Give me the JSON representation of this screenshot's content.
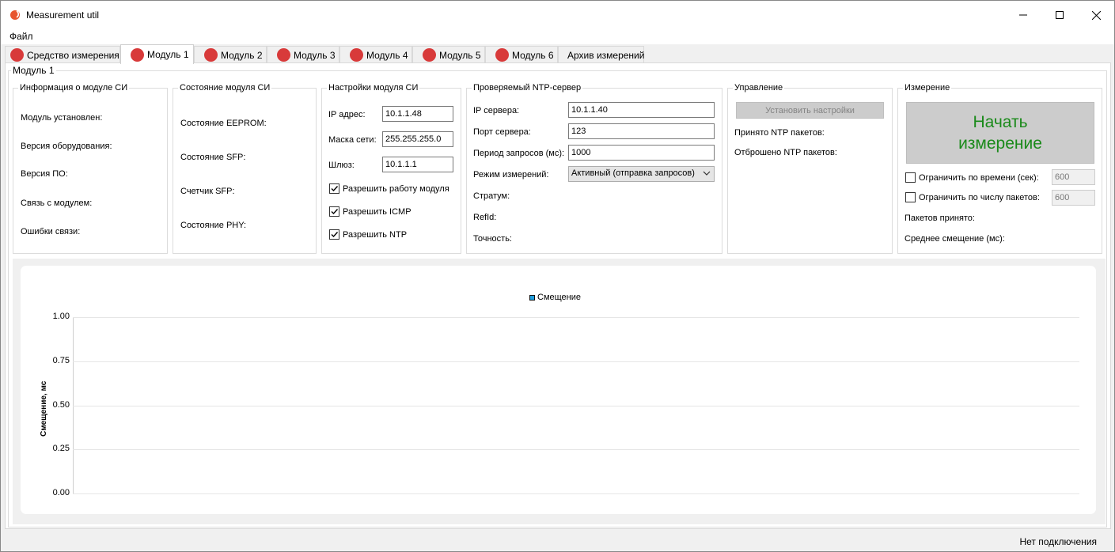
{
  "window": {
    "title": "Measurement util",
    "accent": "#e8552f"
  },
  "menu": {
    "file": "Файл"
  },
  "tabs": [
    {
      "label": "Средство измерения"
    },
    {
      "label": "Модуль 1"
    },
    {
      "label": "Модуль 2"
    },
    {
      "label": "Модуль 3"
    },
    {
      "label": "Модуль 4"
    },
    {
      "label": "Модуль 5"
    },
    {
      "label": "Модуль 6"
    },
    {
      "label": "Архив измерений"
    }
  ],
  "tab_status_color": "#d83a3a",
  "module": {
    "title": "Модуль 1",
    "info": {
      "title": "Информация о модуле СИ",
      "installed": "Модуль установлен:",
      "hw_version": "Версия оборудования:",
      "sw_version": "Версия ПО:",
      "link": "Связь с модулем:",
      "errors": "Ошибки связи:"
    },
    "state": {
      "title": "Состояние модуля СИ",
      "eeprom": "Состояние EEPROM:",
      "sfp": "Состояние SFP:",
      "sfp_counter": "Счетчик SFP:",
      "phy": "Состояние PHY:"
    },
    "settings": {
      "title": "Настройки модуля СИ",
      "ip_label": "IP адрес:",
      "ip_value": "10.1.1.48",
      "mask_label": "Маска сети:",
      "mask_value": "255.255.255.0",
      "gw_label": "Шлюз:",
      "gw_value": "10.1.1.1",
      "enable_module": "Разрешить работу модуля",
      "enable_icmp": "Разрешить ICMP",
      "enable_ntp": "Разрешить NTP"
    },
    "ntp": {
      "title": "Проверяемый NTP-сервер",
      "ip_label": "IP сервера:",
      "ip_value": "10.1.1.40",
      "port_label": "Порт сервера:",
      "port_value": "123",
      "period_label": "Период запросов (мс):",
      "period_value": "1000",
      "mode_label": "Режим измерений:",
      "mode_value": "Активный (отправка запросов)",
      "stratum": "Стратум:",
      "refid": "RefId:",
      "precision": "Точность:"
    },
    "control": {
      "title": "Управление",
      "apply_button": "Установить настройки",
      "received": "Принято NTP пакетов:",
      "dropped": "Отброшено NTP пакетов:"
    },
    "measure": {
      "title": "Измерение",
      "start_line1": "Начать",
      "start_line2": "измерение",
      "limit_time": "Ограничить по времени (сек):",
      "limit_time_value": "600",
      "limit_packets": "Ограничить по числу пакетов:",
      "limit_packets_value": "600",
      "packets_received": "Пакетов принято:",
      "avg_offset": "Среднее смещение (мс):"
    }
  },
  "chart_data": {
    "type": "line",
    "series": [
      {
        "name": "Смещение",
        "values": []
      }
    ],
    "ylabel": "Смещение, мс",
    "ylim": [
      0,
      1
    ],
    "yticks": [
      "1.00",
      "0.75",
      "0.50",
      "0.25",
      "0.00"
    ],
    "legend": "top-center",
    "grid": true,
    "series_color": "#209fdf"
  },
  "status": {
    "text": "Нет подключения"
  }
}
